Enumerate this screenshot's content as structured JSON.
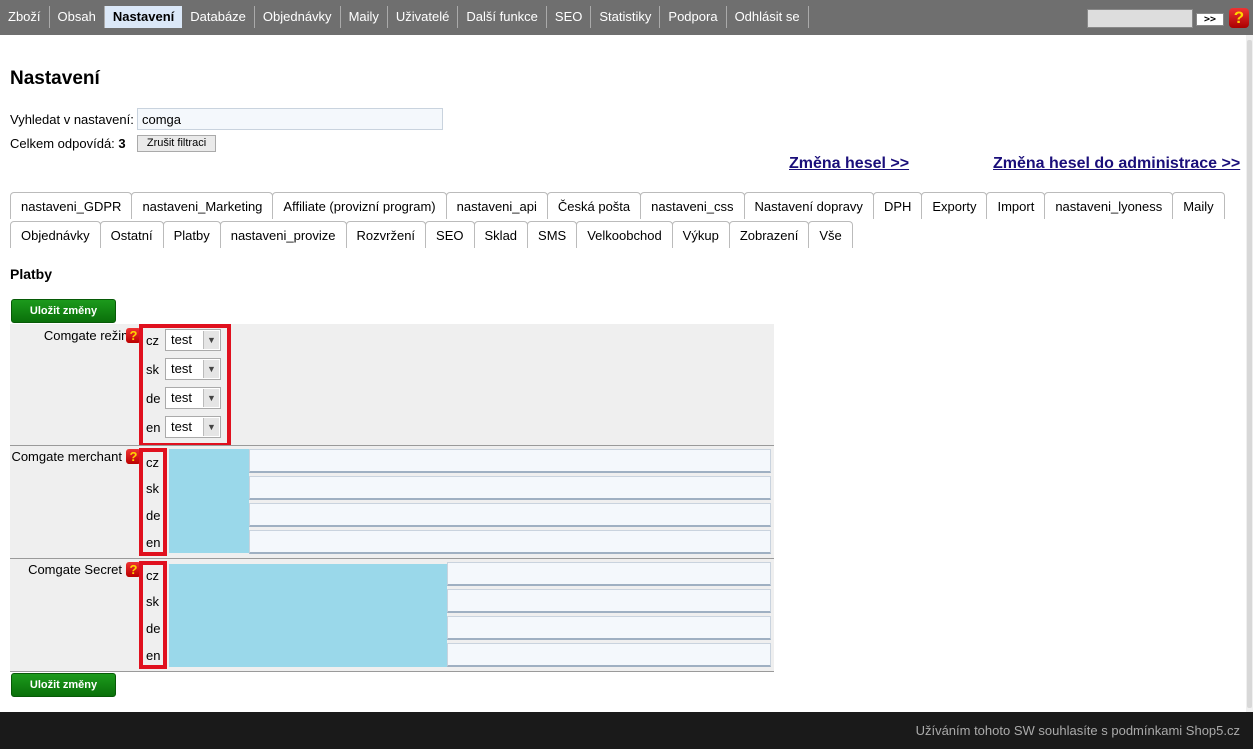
{
  "nav": {
    "items": [
      "Zboží",
      "Obsah",
      "Nastavení",
      "Databáze",
      "Objednávky",
      "Maily",
      "Uživatelé",
      "Další funkce",
      "SEO",
      "Statistiky",
      "Podpora",
      "Odhlásit se"
    ],
    "active": "Nastavení",
    "go_label": ">>",
    "help_glyph": "?"
  },
  "page": {
    "title": "Nastavení",
    "search_label": "Vyhledat v nastavení:",
    "search_value": "comga",
    "total_label": "Celkem odpovídá:",
    "total_count": "3",
    "clear_label": "Zrušit filtraci",
    "link_password": "Změna hesel >>",
    "link_password_admin": "Změna hesel do administrace >>"
  },
  "tabs_row1": [
    "nastaveni_GDPR",
    "nastaveni_Marketing",
    "Affiliate (provizní program)",
    "nastaveni_api",
    "Česká pošta",
    "nastaveni_css",
    "Nastavení dopravy",
    "DPH",
    "Exporty",
    "Import",
    "nastaveni_lyoness",
    "Maily"
  ],
  "tabs_row2": [
    "Objednávky",
    "Ostatní",
    "Platby",
    "nastaveni_provize",
    "Rozvržení",
    "SEO",
    "Sklad",
    "SMS",
    "Velkoobchod",
    "Výkup",
    "Zobrazení",
    "Vše"
  ],
  "section": {
    "title": "Platby",
    "save_label": "Uložit změny",
    "langs": [
      "cz",
      "sk",
      "de",
      "en"
    ],
    "mode": {
      "label": "Comgate režim",
      "values": [
        "test",
        "test",
        "test",
        "test"
      ]
    },
    "merchant": {
      "label": "Comgate merchant"
    },
    "secret": {
      "label": "Comgate Secret"
    }
  },
  "footer": {
    "text": "Užíváním tohoto SW souhlasíte s podmínkami Shop5.cz"
  },
  "colors": {
    "accent_red": "#e0101e",
    "save_green": "#108a10",
    "redacted_blue": "#9ad8ea"
  }
}
